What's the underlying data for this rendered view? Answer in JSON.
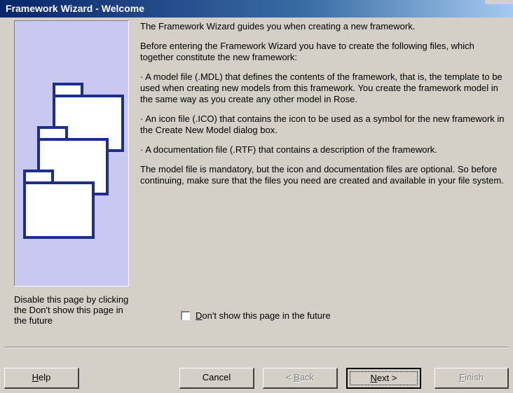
{
  "window": {
    "title": "Framework Wizard - Welcome"
  },
  "content": {
    "paragraphs": [
      "The Framework Wizard guides you when creating a new framework.",
      "Before entering the Framework Wizard you have to create the following files, which together constitute the new framework:",
      "· A model file (.MDL) that defines the contents of the framework, that is, the template to be used when creating new models from this framework. You create the framework model in the same way as you create any other model in Rose.",
      "· An icon file (.ICO) that contains the icon to be used as a symbol for the new framework in the Create New Model dialog box.",
      "· A documentation file (.RTF) that contains a description of the framework.",
      "The model file is mandatory, but the icon and documentation files are optional. So before continuing, make sure that the files you need are created and available in your file system."
    ]
  },
  "side_note": "Disable this page by clicking the Don't show this page in the future",
  "checkbox": {
    "mnemonic": "D",
    "label_rest": "on't show this page in the future",
    "checked": false
  },
  "buttons": {
    "help": {
      "mnemonic": "H",
      "rest": "elp"
    },
    "cancel": {
      "label": "Cancel"
    },
    "back": {
      "prefix": "< ",
      "mnemonic": "B",
      "rest": "ack"
    },
    "next": {
      "mnemonic": "N",
      "rest": "ext >"
    },
    "finish": {
      "mnemonic": "F",
      "rest": "inish"
    }
  },
  "colors": {
    "titlebar": "#0a246a",
    "dialog_bg": "#d4d0c8",
    "graphic_bg": "#c8c8f0",
    "folder_stroke": "#1c2f8c"
  },
  "graphic": {
    "icon": "stacked-folders-icon"
  }
}
